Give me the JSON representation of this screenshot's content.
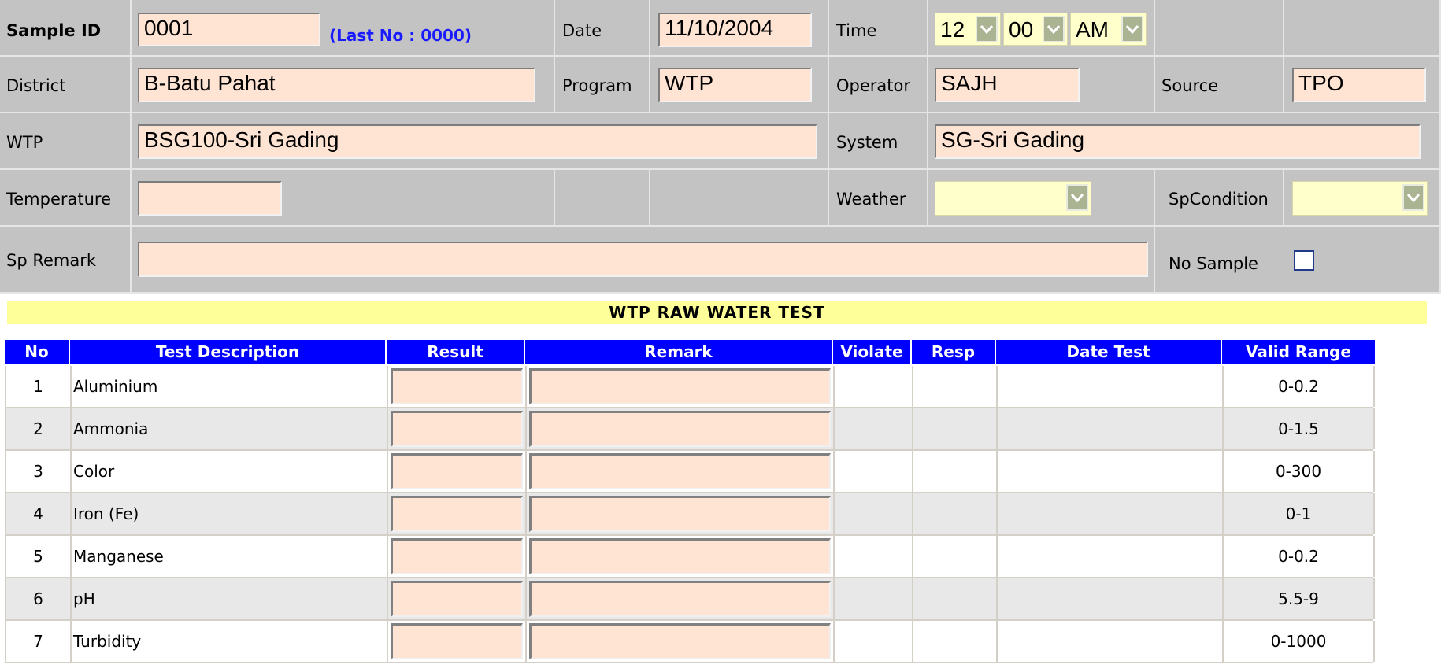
{
  "form": {
    "sample_id_label": "Sample ID",
    "sample_id_value": "0001",
    "last_no_text": "(Last No : 0000)",
    "date_label": "Date",
    "date_value": "11/10/2004",
    "time_label": "Time",
    "time_hour": "12",
    "time_minute": "00",
    "time_ampm": "AM",
    "district_label": "District",
    "district_value": "B-Batu Pahat",
    "program_label": "Program",
    "program_value": "WTP",
    "operator_label": "Operator",
    "operator_value": "SAJH",
    "source_label": "Source",
    "source_value": "TPO",
    "wtp_label": "WTP",
    "wtp_value": "BSG100-Sri Gading",
    "system_label": "System",
    "system_value": "SG-Sri Gading",
    "temperature_label": "Temperature",
    "temperature_value": "",
    "weather_label": "Weather",
    "weather_value": "",
    "spcondition_label": "SpCondition",
    "spcondition_value": "",
    "sp_remark_label": "Sp Remark",
    "sp_remark_value": "",
    "no_sample_label": "No Sample",
    "no_sample_checked": false
  },
  "banner": "WTP RAW WATER TEST",
  "table": {
    "headers": [
      "No",
      "Test Description",
      "Result",
      "Remark",
      "Violate",
      "Resp",
      "Date Test",
      "Valid Range"
    ],
    "rows": [
      {
        "no": "1",
        "desc": "Aluminium",
        "range": "0-0.2"
      },
      {
        "no": "2",
        "desc": "Ammonia",
        "range": "0-1.5"
      },
      {
        "no": "3",
        "desc": "Color",
        "range": "0-300"
      },
      {
        "no": "4",
        "desc": "Iron (Fe)",
        "range": "0-1"
      },
      {
        "no": "5",
        "desc": "Manganese",
        "range": "0-0.2"
      },
      {
        "no": "6",
        "desc": "pH",
        "range": "5.5-9"
      },
      {
        "no": "7",
        "desc": "Turbidity",
        "range": "0-1000"
      }
    ]
  },
  "colors": {
    "header_blue": "#0000ff",
    "input_fill": "#ffe4d4",
    "select_fill": "#ffffcc",
    "banner_fill": "#ffff99",
    "last_no_blue": "#1a1aff"
  }
}
